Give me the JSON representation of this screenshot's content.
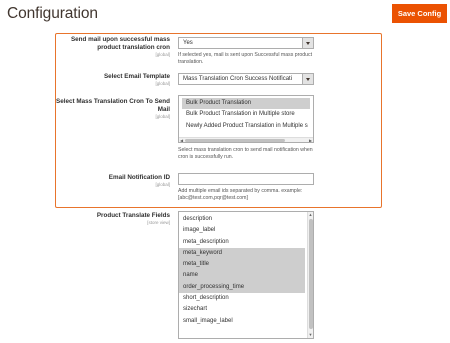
{
  "header": {
    "title": "Configuration",
    "save_label": "Save Config"
  },
  "fields": {
    "send_mail": {
      "label": "Send mail upon successful mass product translation cron",
      "scope": "[global]",
      "value": "Yes",
      "note": "If selected yes, mail is sent upon Successful mass product translation."
    },
    "email_template": {
      "label": "Select Email Template",
      "scope": "[global]",
      "value": "Mass Translation Cron Success Notificati"
    },
    "cron_select": {
      "label": "Select Mass Translation Cron To Send Mail",
      "scope": "[global]",
      "options": [
        {
          "label": "Bulk Product Translation",
          "selected": true
        },
        {
          "label": "Bulk Product Translation in Multiple store",
          "selected": false
        },
        {
          "label": "Newly Added Product Translation in Multiple s",
          "selected": false
        }
      ],
      "note": "Select mass translation cron to send mail notification when cron is successfully run."
    },
    "email_notification": {
      "label": "Email Notification ID",
      "scope": "[global]",
      "value": "",
      "note": "Add multiple email ids separated by comma. example: [abc@test.com,pqr@test.com]"
    },
    "translate_fields": {
      "label": "Product Translate Fields",
      "scope": "[store view]",
      "options": [
        {
          "label": "description",
          "selected": false
        },
        {
          "label": "image_label",
          "selected": false
        },
        {
          "label": "meta_description",
          "selected": false
        },
        {
          "label": "meta_keyword",
          "selected": true
        },
        {
          "label": "meta_title",
          "selected": true
        },
        {
          "label": "name",
          "selected": true
        },
        {
          "label": "order_processing_time",
          "selected": true
        },
        {
          "label": "short_description",
          "selected": false
        },
        {
          "label": "sizechart",
          "selected": false
        },
        {
          "label": "small_image_label",
          "selected": false
        }
      ]
    }
  },
  "colors": {
    "accent": "#eb5202",
    "highlight_border": "#e8742c",
    "selected_option_bg": "#cecece"
  }
}
